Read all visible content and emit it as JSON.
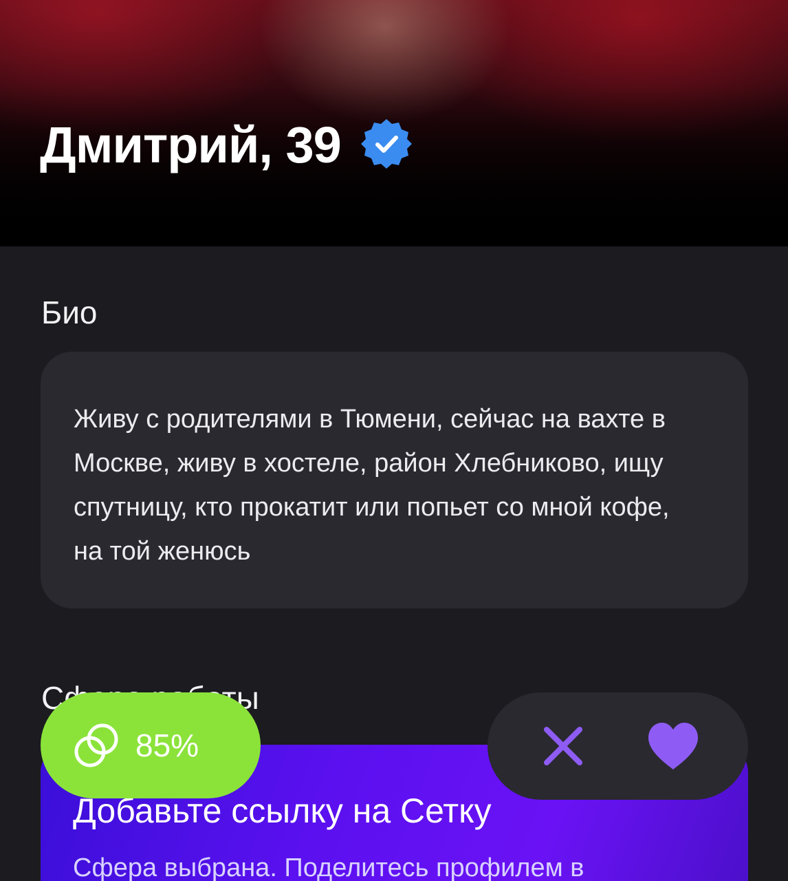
{
  "profile": {
    "name_age": "Дмитрий, 39",
    "verified_icon": "verified-badge-icon"
  },
  "bio": {
    "heading": "Био",
    "text": "Живу с родителями в Тюмени, сейчас на вахте в Москве, живу в хостеле, район Хлебниково, ищу спутницу, кто прокатит или попьет со мной кофе, на той женюсь"
  },
  "work": {
    "heading": "Сфера работы",
    "promo_title": "Добавьте ссылку на Сетку",
    "promo_subtitle": "Сфера выбрана. Поделитесь профилем в"
  },
  "match": {
    "value": "85%",
    "icon": "rings-icon",
    "color": "#8be33a"
  },
  "actions": {
    "dislike_icon": "close-icon",
    "like_icon": "heart-icon",
    "accent": "#8e5cf5"
  },
  "colors": {
    "background": "#1c1b20",
    "card": "#2a2930",
    "verified": "#3b8cf0"
  }
}
